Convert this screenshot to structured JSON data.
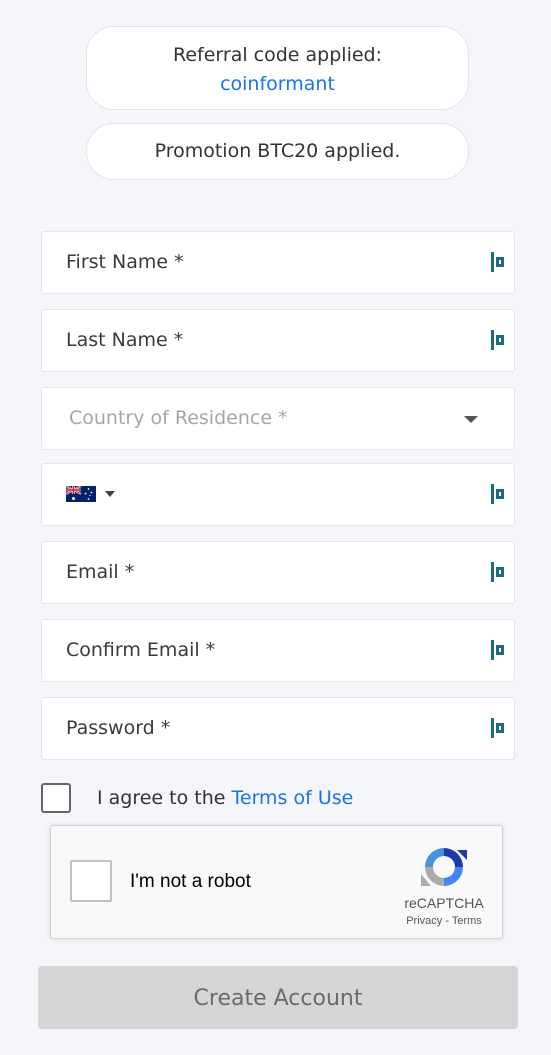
{
  "promo": {
    "referral_text": "Referral code applied:",
    "referral_code": "coinformant",
    "promotion_text": "Promotion BTC20 applied."
  },
  "form": {
    "first_name_placeholder": "First Name *",
    "last_name_placeholder": "Last Name *",
    "country_placeholder": "Country of Residence *",
    "phone_country_flag": "australia-flag-icon",
    "email_placeholder": "Email *",
    "confirm_email_placeholder": "Confirm Email *",
    "password_placeholder": "Password *",
    "field_icon": "lastpass-autofill-icon"
  },
  "terms": {
    "prefix": "I agree to the ",
    "link": "Terms of Use"
  },
  "recaptcha": {
    "label": "I'm not a robot",
    "brand": "reCAPTCHA",
    "privacy": "Privacy",
    "separator": " - ",
    "terms": "Terms"
  },
  "submit": {
    "label": "Create Account"
  },
  "colors": {
    "background": "#f4f6fa",
    "link": "#1a73e8",
    "icon": "#1d6c7a",
    "button_disabled": "#d6d6d6"
  }
}
